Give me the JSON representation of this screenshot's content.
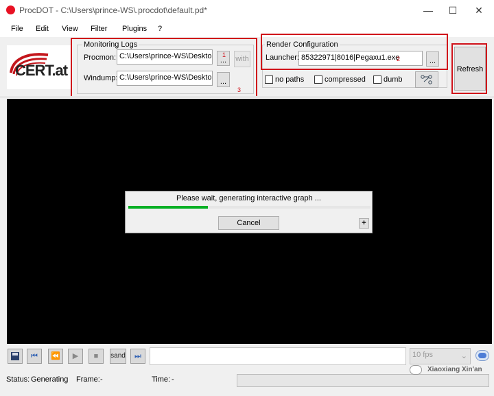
{
  "window": {
    "title": "ProcDOT - C:\\Users\\prince-WS\\.procdot\\default.pd*",
    "minimize": "—",
    "maximize": "☐",
    "close": "✕"
  },
  "menu": {
    "items": [
      "File",
      "Edit",
      "View",
      "Filter",
      "Plugins",
      "?"
    ]
  },
  "logo": {
    "text": "CERT.at"
  },
  "monitoring": {
    "legend": "Monitoring Logs",
    "procmon_label": "Procmon:",
    "procmon_value": "C:\\Users\\prince-WS\\Desktop\\l",
    "windump_label": "Windump:",
    "windump_value": "C:\\Users\\prince-WS\\Desktop\\l",
    "browse_label": "...",
    "with_label": "with"
  },
  "render": {
    "legend": "Render Configuration",
    "launcher_label": "Launcher:",
    "launcher_value": "85322971|8016|Pegaxu1.exe",
    "browse_label": "...",
    "options": [
      "no paths",
      "compressed",
      "dumb"
    ]
  },
  "refresh": {
    "label": "Refresh"
  },
  "annotations": [
    "1",
    "2",
    "3"
  ],
  "dialog": {
    "message": "Please wait, generating interactive graph ...",
    "progress": 0.33,
    "cancel_label": "Cancel",
    "expand_label": "+"
  },
  "toolbar": {
    "sand_label": "sand",
    "fps_value": "10 fps"
  },
  "status": {
    "status_label": "Status:",
    "status_value": "Generating",
    "frame_label": "Frame:",
    "frame_value": "-",
    "time_label": "Time:",
    "time_value": "-"
  },
  "watermark": {
    "text": "Xiaoxiang Xin'an"
  },
  "colors": {
    "annotation_red": "#d0121a",
    "progress_green": "#06b025",
    "canvas": "#000000",
    "app_icon": "#e81123"
  }
}
